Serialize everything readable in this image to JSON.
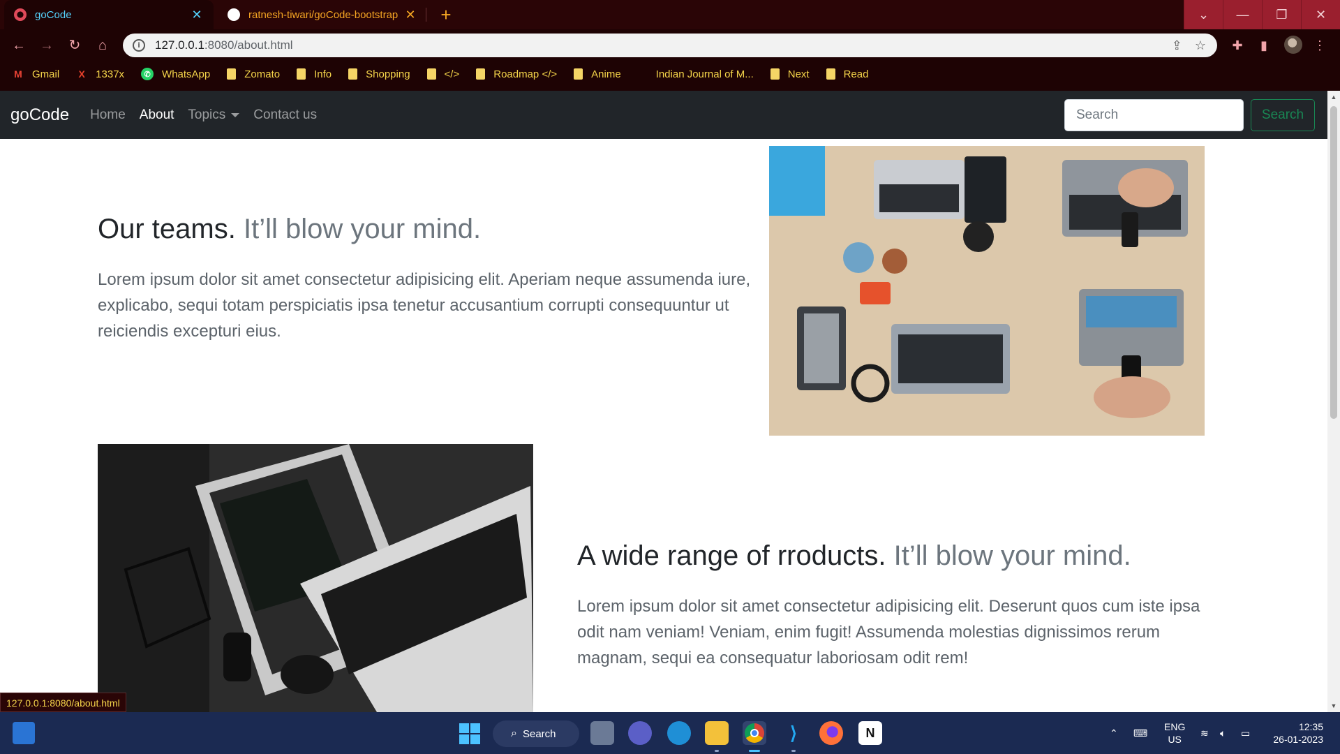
{
  "browser": {
    "tabs": [
      {
        "title": "goCode",
        "close": "✕"
      },
      {
        "title": "ratnesh-tiwari/goCode-bootstrap",
        "close": "✕"
      }
    ],
    "new_tab": "+",
    "url_host": "127.0.0.1",
    "url_rest": ":8080/about.html",
    "bookmarks": [
      "Gmail",
      "1337x",
      "WhatsApp",
      "Zomato",
      "Info",
      "Shopping",
      "</>",
      "Roadmap </>",
      "Anime",
      "Indian Journal of M...",
      "Next",
      "Read"
    ],
    "status_url": "127.0.0.1:8080/about.html",
    "accent_active_tab": "#55d4ff",
    "accent_bookmarks": "#f5d54a"
  },
  "site": {
    "brand": "goCode",
    "nav": [
      {
        "label": "Home"
      },
      {
        "label": "About"
      },
      {
        "label": "Topics"
      },
      {
        "label": "Contact us"
      }
    ],
    "search_placeholder": "Search",
    "search_button": "Search"
  },
  "features": [
    {
      "heading": "Our teams.",
      "heading_muted": "It’ll blow your mind.",
      "text": "Lorem ipsum dolor sit amet consectetur adipisicing elit. Aperiam neque assumenda iure, explicabo, sequi totam perspiciatis ipsa tenetur accusantium corrupti consequuntur ut reiciendis excepturi eius."
    },
    {
      "heading": "A wide range of rroducts.",
      "heading_muted": "It’ll blow your mind.",
      "text": "Lorem ipsum dolor sit amet consectetur adipisicing elit. Deserunt quos cum iste ipsa odit nam veniam! Veniam, enim fugit! Assumenda molestias dignissimos rerum magnam, sequi ea consequatur laboriosam odit rem!"
    }
  ],
  "taskbar": {
    "search_label": "Search",
    "lang_line1": "ENG",
    "lang_line2": "US",
    "time": "12:35",
    "date": "26-01-2023"
  }
}
